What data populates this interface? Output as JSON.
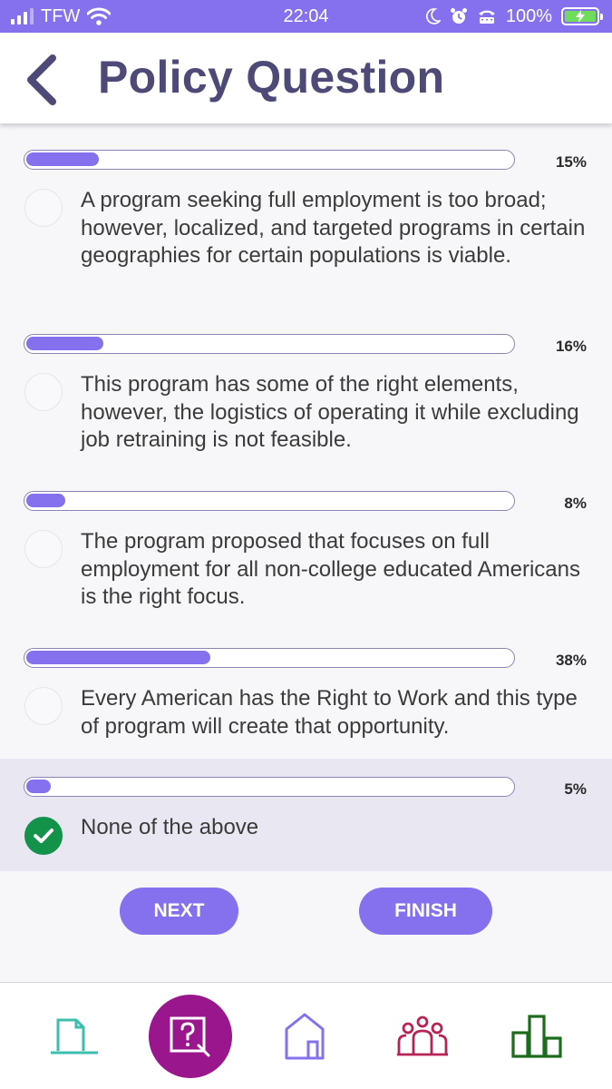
{
  "status_bar": {
    "carrier": "TFW",
    "time": "22:04",
    "battery_percent": "100%",
    "icons": [
      "signal-icon",
      "wifi-icon",
      "moon-icon",
      "alarm-icon",
      "tty-icon",
      "battery-icon"
    ]
  },
  "header": {
    "title": "Policy Question",
    "back_icon": "chevron-left-icon"
  },
  "options": [
    {
      "percent_label": "15%",
      "percent": 15,
      "text": "A program seeking full employment is too broad; however, localized, and targeted programs in certain geographies for certain populations is viable.",
      "selected": false
    },
    {
      "percent_label": "16%",
      "percent": 16,
      "text": "This program has some of the right elements, however, the logistics of operating it while excluding job retraining is not feasible.",
      "selected": false
    },
    {
      "percent_label": "8%",
      "percent": 8,
      "text": "The program proposed that focuses on full employment for all non-college educated Americans is the right focus.",
      "selected": false
    },
    {
      "percent_label": "38%",
      "percent": 38,
      "text": "Every American has the Right to Work and this type of program will create that opportunity.",
      "selected": false
    },
    {
      "percent_label": "5%",
      "percent": 5,
      "text": "None of the above",
      "selected": true
    }
  ],
  "actions": {
    "next_label": "NEXT",
    "finish_label": "FINISH"
  },
  "bottom_nav": [
    {
      "icon": "document-icon",
      "active": false
    },
    {
      "icon": "question-icon",
      "active": true
    },
    {
      "icon": "home-icon",
      "active": false
    },
    {
      "icon": "community-icon",
      "active": false
    },
    {
      "icon": "bar-chart-icon",
      "active": false
    }
  ],
  "colors": {
    "accent": "#8570ee",
    "title": "#4d4a78",
    "checked": "#13924a",
    "nav_active": "#9a168c",
    "nav_document": "#3bbfad",
    "nav_community": "#b82355",
    "nav_chart": "#1d6b1d"
  }
}
